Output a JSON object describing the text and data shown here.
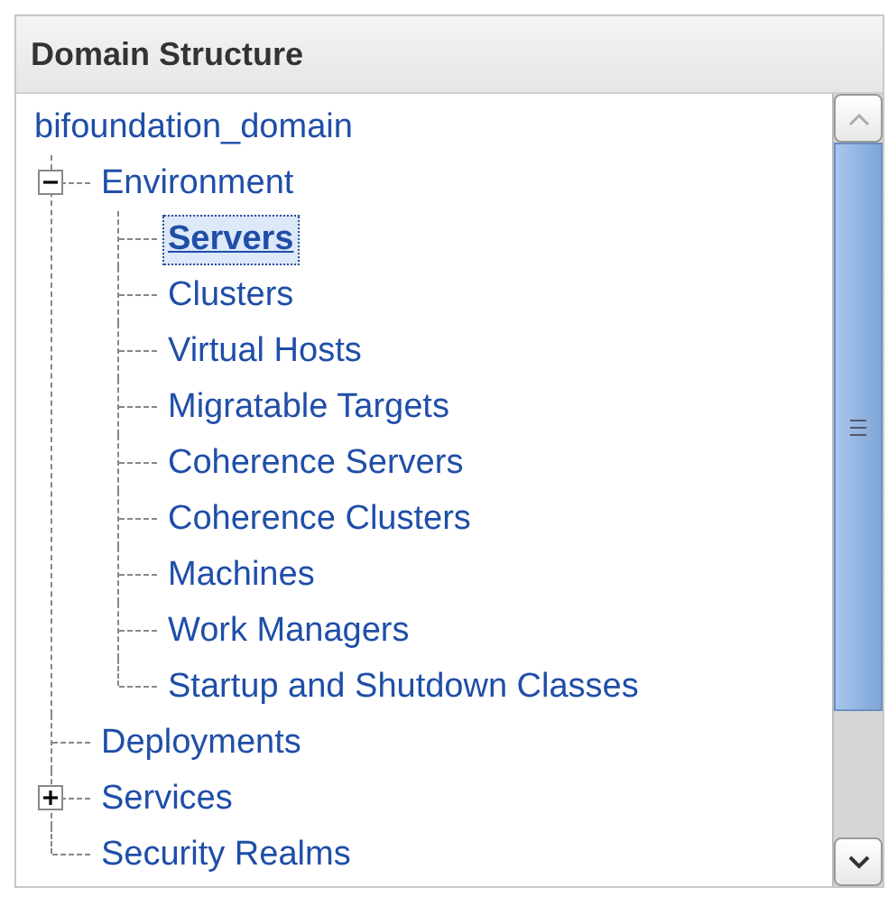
{
  "panel": {
    "title": "Domain Structure"
  },
  "tree": {
    "label": "bifoundation_domain",
    "selected": false,
    "children": [
      {
        "label": "Environment",
        "selected": false,
        "expanded": true,
        "children": [
          {
            "label": "Servers",
            "selected": true
          },
          {
            "label": "Clusters",
            "selected": false
          },
          {
            "label": "Virtual Hosts",
            "selected": false
          },
          {
            "label": "Migratable Targets",
            "selected": false
          },
          {
            "label": "Coherence Servers",
            "selected": false
          },
          {
            "label": "Coherence Clusters",
            "selected": false
          },
          {
            "label": "Machines",
            "selected": false
          },
          {
            "label": "Work Managers",
            "selected": false
          },
          {
            "label": "Startup and Shutdown Classes",
            "selected": false
          }
        ]
      },
      {
        "label": "Deployments",
        "selected": false
      },
      {
        "label": "Services",
        "selected": false,
        "expanded": false
      },
      {
        "label": "Security Realms",
        "selected": false
      }
    ]
  }
}
